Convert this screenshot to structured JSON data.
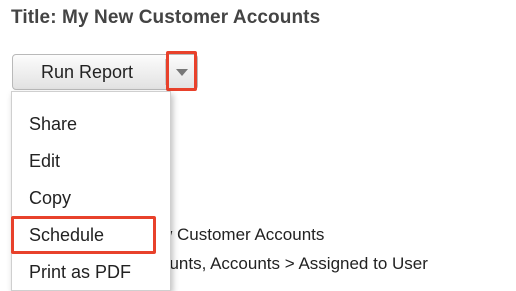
{
  "report": {
    "title": "Title: My New Customer Accounts"
  },
  "toolbar": {
    "run_report_label": "Run Report",
    "dropdown_icon": "chevron-down-icon"
  },
  "dropdown": {
    "items": [
      {
        "label": "Share"
      },
      {
        "label": "Edit"
      },
      {
        "label": "Copy"
      },
      {
        "label": "Schedule",
        "highlighted": true
      },
      {
        "label": "Print as PDF"
      }
    ]
  },
  "details_behind": {
    "lines": [
      "w Customer Accounts",
      "ounts, Accounts > Assigned to User",
      ""
    ]
  },
  "colors": {
    "highlight": "#e8412b",
    "text": "#222222",
    "title": "#444444"
  }
}
